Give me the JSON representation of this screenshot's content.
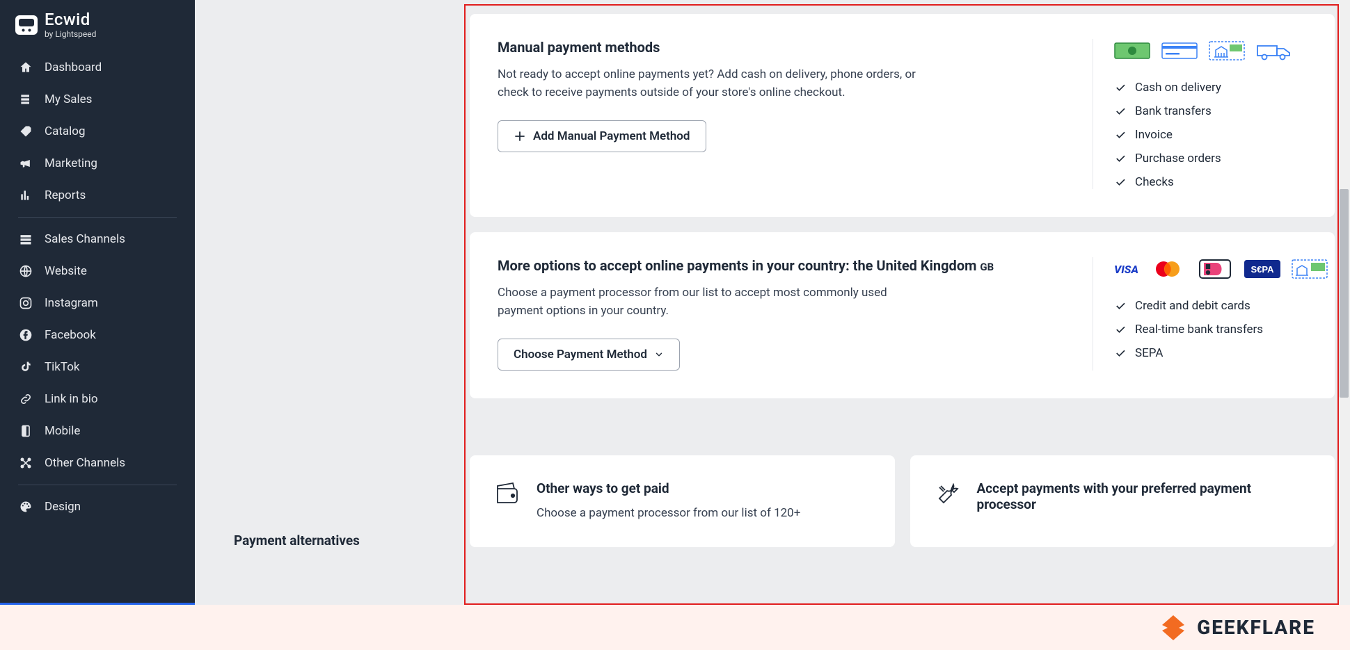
{
  "brand": {
    "name": "Ecwid",
    "sub": "by Lightspeed"
  },
  "sidebar": {
    "items": [
      {
        "label": "Dashboard",
        "icon": "home-icon"
      },
      {
        "label": "My Sales",
        "icon": "sales-icon"
      },
      {
        "label": "Catalog",
        "icon": "tag-icon"
      },
      {
        "label": "Marketing",
        "icon": "megaphone-icon"
      },
      {
        "label": "Reports",
        "icon": "chart-icon"
      },
      {
        "label": "Sales Channels",
        "icon": "channels-icon"
      },
      {
        "label": "Website",
        "icon": "globe-icon"
      },
      {
        "label": "Instagram",
        "icon": "instagram-icon"
      },
      {
        "label": "Facebook",
        "icon": "facebook-icon"
      },
      {
        "label": "TikTok",
        "icon": "tiktok-icon"
      },
      {
        "label": "Link in bio",
        "icon": "link-icon"
      },
      {
        "label": "Mobile",
        "icon": "mobile-icon"
      },
      {
        "label": "Other Channels",
        "icon": "other-icon"
      },
      {
        "label": "Design",
        "icon": "design-icon"
      }
    ]
  },
  "section_label": "Payment alternatives",
  "manual_card": {
    "title": "Manual payment methods",
    "desc": "Not ready to accept online payments yet? Add cash on delivery, phone orders, or check to receive payments outside of your store's online checkout.",
    "button": "Add Manual Payment Method",
    "features": [
      "Cash on delivery",
      "Bank transfers",
      "Invoice",
      "Purchase orders",
      "Checks"
    ]
  },
  "online_card": {
    "title_a": "More options to accept online payments in your country: the United Kingdom ",
    "title_code": "GB",
    "desc": "Choose a payment processor from our list to accept most commonly used payment options in your country.",
    "button": "Choose Payment Method",
    "features": [
      "Credit and debit cards",
      "Real-time bank transfers",
      "SEPA"
    ]
  },
  "alt_cards": {
    "left": {
      "title": "Other ways to get paid",
      "desc": "Choose a payment processor from our list of 120+"
    },
    "right": {
      "title": "Accept payments with your preferred payment processor",
      "desc": ""
    }
  },
  "footer_brand": "GEEKFLARE"
}
